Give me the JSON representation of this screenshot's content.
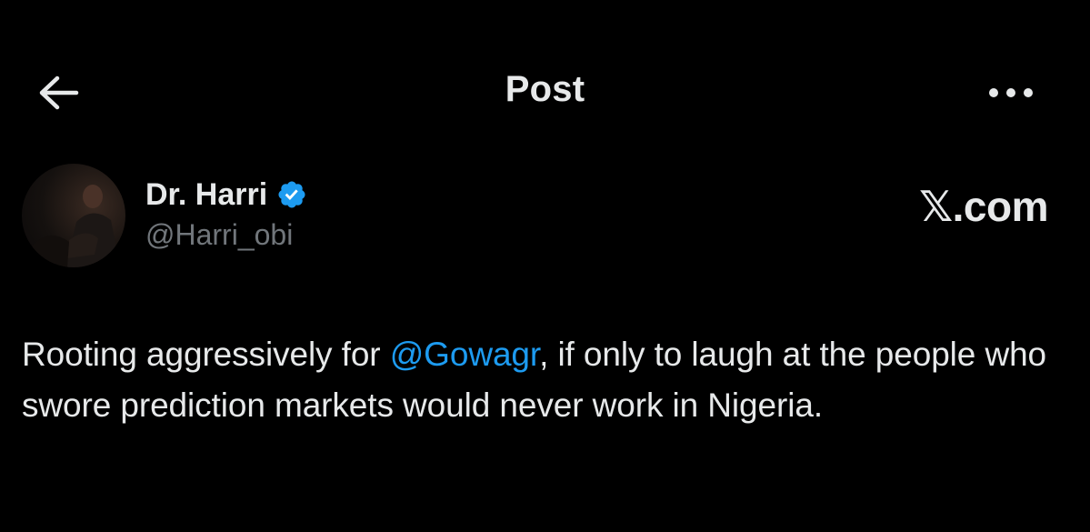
{
  "header": {
    "title": "Post",
    "back_icon": "arrow-left-icon",
    "more_icon": "more-horizontal-icon"
  },
  "author": {
    "display_name": "Dr. Harri",
    "handle": "@Harri_obi",
    "verified": true,
    "verified_color": "#1d9bf0"
  },
  "watermark": "𝕏.com",
  "post": {
    "text_before": "Rooting aggressively for ",
    "mention": "@Gowagr",
    "text_after": ", if only to laugh at the people who swore prediction markets would never work in Nigeria."
  },
  "colors": {
    "background": "#000000",
    "text": "#e7e9ea",
    "secondary": "#71767b",
    "accent": "#1d9bf0"
  }
}
